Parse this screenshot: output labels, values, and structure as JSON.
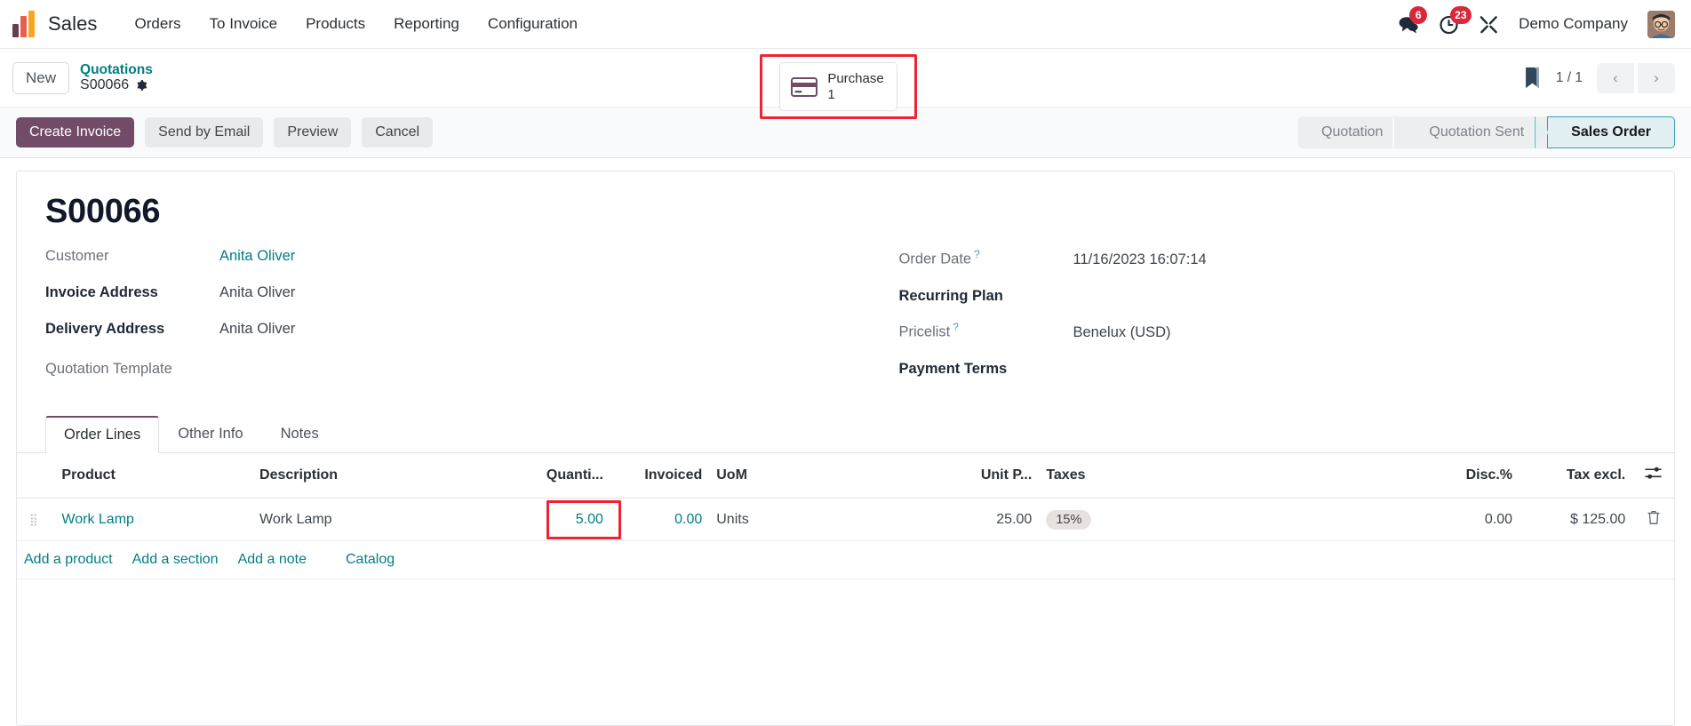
{
  "navbar": {
    "brand": "Sales",
    "menu": [
      "Orders",
      "To Invoice",
      "Products",
      "Reporting",
      "Configuration"
    ],
    "messages_count": "6",
    "activities_count": "23",
    "company": "Demo Company",
    "icons": {
      "messages": "chat-bubble-icon",
      "activities": "clock-icon",
      "debug": "tools-icon",
      "avatar": "user-avatar"
    }
  },
  "breadcrumb": {
    "new_label": "New",
    "parent": "Quotations",
    "current": "S00066",
    "settings_icon": "gear-icon"
  },
  "stat_button": {
    "label": "Purchase",
    "value": "1",
    "icon": "credit-card-icon",
    "highlighted": true,
    "highlight_color": "#ee2434"
  },
  "pager": {
    "bookmark_icon": "bookmark-icon",
    "count": "1 / 1",
    "prev": "‹",
    "next": "›"
  },
  "actions": {
    "primary": "Create Invoice",
    "secondary": [
      "Send by Email",
      "Preview",
      "Cancel"
    ]
  },
  "statusbar": {
    "stages": [
      "Quotation",
      "Quotation Sent",
      "Sales Order"
    ],
    "active": "Sales Order",
    "active_color": "#3aa0ad"
  },
  "record": {
    "title": "S00066",
    "left_fields": [
      {
        "label": "Customer",
        "qmark": false,
        "bold": false,
        "value": "Anita Oliver",
        "link": true
      },
      {
        "label": "Invoice Address",
        "qmark": false,
        "bold": true,
        "value": "Anita Oliver",
        "link": false
      },
      {
        "label": "Delivery Address",
        "qmark": false,
        "bold": true,
        "value": "Anita Oliver",
        "link": false
      },
      {
        "label": "Quotation Template",
        "qmark": false,
        "bold": false,
        "value": "",
        "link": false
      }
    ],
    "right_fields": [
      {
        "label": "Order Date",
        "qmark": true,
        "bold": false,
        "value": "11/16/2023 16:07:14",
        "link": false
      },
      {
        "label": "Recurring Plan",
        "qmark": false,
        "bold": true,
        "value": "",
        "link": false
      },
      {
        "label": "Pricelist",
        "qmark": true,
        "bold": false,
        "value": "Benelux (USD)",
        "link": false
      },
      {
        "label": "Payment Terms",
        "qmark": false,
        "bold": true,
        "value": "",
        "link": false
      }
    ]
  },
  "notebook": {
    "tabs": [
      "Order Lines",
      "Other Info",
      "Notes"
    ],
    "active_tab": "Order Lines"
  },
  "order_lines": {
    "columns": {
      "product": "Product",
      "description": "Description",
      "quantity": "Quanti...",
      "invoiced": "Invoiced",
      "uom": "UoM",
      "unit_price": "Unit P...",
      "taxes": "Taxes",
      "discount": "Disc.%",
      "tax_excl": "Tax excl.",
      "options_icon": "column-options-icon"
    },
    "rows": [
      {
        "handle_icon": "drag-handle-icon",
        "product": "Work Lamp",
        "description": "Work Lamp",
        "quantity": "5.00",
        "quantity_highlighted": true,
        "invoiced": "0.00",
        "uom": "Units",
        "unit_price": "25.00",
        "taxes": "15%",
        "discount": "0.00",
        "tax_excl": "$ 125.00",
        "delete_icon": "trash-icon"
      }
    ],
    "add_links": [
      "Add a product",
      "Add a section",
      "Add a note",
      "Catalog"
    ]
  }
}
